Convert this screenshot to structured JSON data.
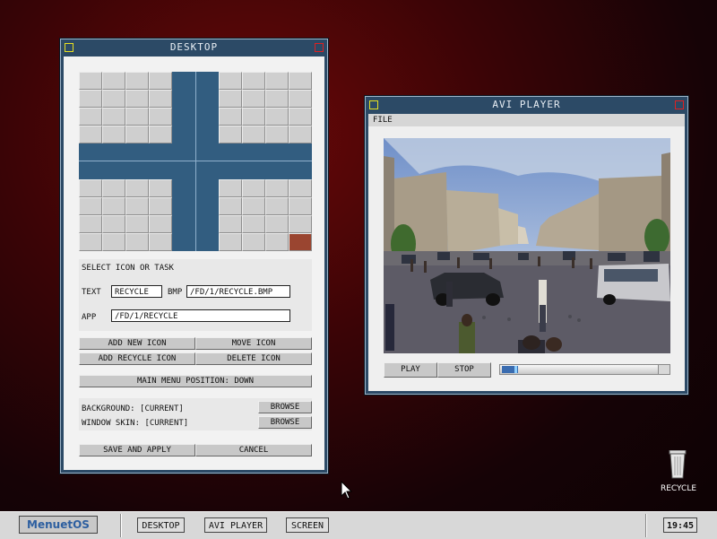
{
  "desktop_window": {
    "title": "DESKTOP",
    "select_label": "SELECT ICON OR TASK",
    "text_label": "TEXT",
    "text_value": "RECYCLE",
    "bmp_label": "BMP",
    "bmp_value": "/FD/1/RECYCLE.BMP",
    "app_label": "APP",
    "app_value": "/FD/1/RECYCLE",
    "buttons": {
      "add_new_icon": "ADD NEW ICON",
      "move_icon": "MOVE ICON",
      "add_recycle_icon": "ADD RECYCLE ICON",
      "delete_icon": "DELETE ICON",
      "main_menu_position": "MAIN MENU POSITION: DOWN",
      "browse": "BROWSE",
      "save_and_apply": "SAVE AND APPLY",
      "cancel": "CANCEL"
    },
    "background_label": "BACKGROUND: [CURRENT]",
    "window_skin_label": "WINDOW SKIN: [CURRENT]"
  },
  "avi_window": {
    "title": "AVI PLAYER",
    "menu_file": "FILE",
    "play": "PLAY",
    "stop": "STOP",
    "progress": 0.1
  },
  "desktop_icons": {
    "recycle_label": "RECYCLE"
  },
  "taskbar": {
    "logo": "MenuetOS",
    "tasks": [
      "DESKTOP",
      "AVI PLAYER",
      "SCREEN"
    ],
    "clock": "19:45"
  },
  "colors": {
    "window_frame": "#2c4a66",
    "grid_accent": "#325d80",
    "selected_cell": "#9a4530"
  }
}
